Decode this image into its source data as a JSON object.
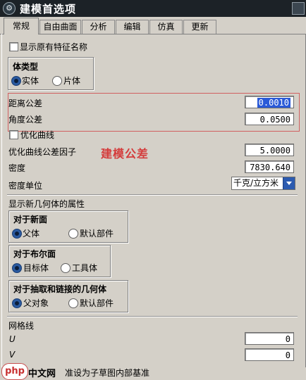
{
  "title": "建模首选项",
  "tabs": [
    "常规",
    "自由曲面",
    "分析",
    "编辑",
    "仿真",
    "更新"
  ],
  "show_original_feature_names": {
    "label": "显示原有特征名称",
    "checked": false
  },
  "body_type": {
    "title": "体类型",
    "options": [
      "实体",
      "片体"
    ],
    "selected": "实体"
  },
  "distance_tolerance": {
    "label": "距离公差",
    "value": "0.0010"
  },
  "angle_tolerance": {
    "label": "角度公差",
    "value": "0.0500"
  },
  "optimize_curves": {
    "label": "优化曲线",
    "checked": false
  },
  "annotation": "建模公差",
  "optimize_factor": {
    "label": "优化曲线公差因子",
    "value": "5.0000"
  },
  "density": {
    "label": "密度",
    "value": "7830.640"
  },
  "density_unit": {
    "label": "密度单位",
    "value": "千克/立方米"
  },
  "new_geometry_section": "显示新几何体的属性",
  "new_face": {
    "title": "对于新面",
    "options": [
      "父体",
      "默认部件"
    ],
    "selected": "父体"
  },
  "boolean_face": {
    "title": "对于布尔面",
    "options": [
      "目标体",
      "工具体"
    ],
    "selected": "目标体"
  },
  "extracted_geometry": {
    "title": "对于抽取和链接的几何体",
    "options": [
      "父对象",
      "默认部件"
    ],
    "selected": "父对象"
  },
  "grid_lines": {
    "title": "网格线",
    "u_label": "U",
    "u_value": "0",
    "v_label": "V",
    "v_value": "0"
  },
  "footer": {
    "watermark": "php",
    "site": "中文网",
    "text": "准设为子草图内部基准"
  }
}
